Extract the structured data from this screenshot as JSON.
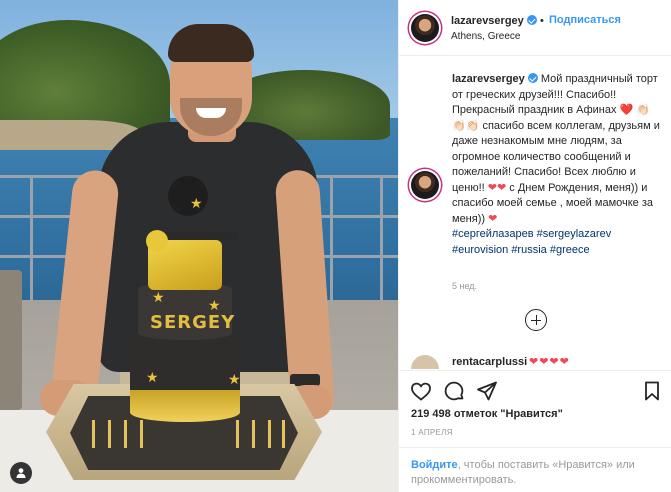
{
  "post": {
    "username": "lazarevsergey",
    "separator": "•",
    "follow_label": "Подписаться",
    "location": "Athens, Greece"
  },
  "photo": {
    "cake_text": "SERGEY"
  },
  "caption": {
    "username": "lazarevsergey",
    "text_1": "Мой праздничный торт от греческих друзей!!! Спасибо!! Прекрасный праздник в Афинах",
    "hearts_1": "❤️",
    "hands_1": "👏🏻👏🏻👏🏻",
    "text_2": "спасибо всем коллегам, друзьям и даже незнакомым мне людям, за огромное количество сообщений и пожеланий! Спасибо! Всех люблю и ценю!!",
    "hearts_2": "❤❤",
    "text_3": "с Днем Рождения, меня)) и спасибо моей семье , моей мамочке за меня))",
    "hearts_3": "❤",
    "hashtags": "#сергейлазарев #sergeylazarev #eurovision #russia #greece",
    "age": "5 нед."
  },
  "comment": {
    "username": "rentacarplussi",
    "text": "❤❤❤❤"
  },
  "actions": {
    "likes_count": "219 498",
    "likes_suffix": "отметок \"Нравится\"",
    "date": "1 АПРЕЛЯ"
  },
  "login_prompt": {
    "link": "Войдите",
    "text": ", чтобы поставить «Нравится» или прокомментировать."
  },
  "icons": [
    "user-tag-icon",
    "verified-icon",
    "add-comment-icon",
    "heart-icon",
    "comment-icon",
    "share-icon",
    "bookmark-icon"
  ],
  "colors": {
    "link_blue": "#3897f0",
    "text": "#262626",
    "muted": "#999999",
    "heart_red": "#ed4956",
    "hashtag": "#003569"
  }
}
